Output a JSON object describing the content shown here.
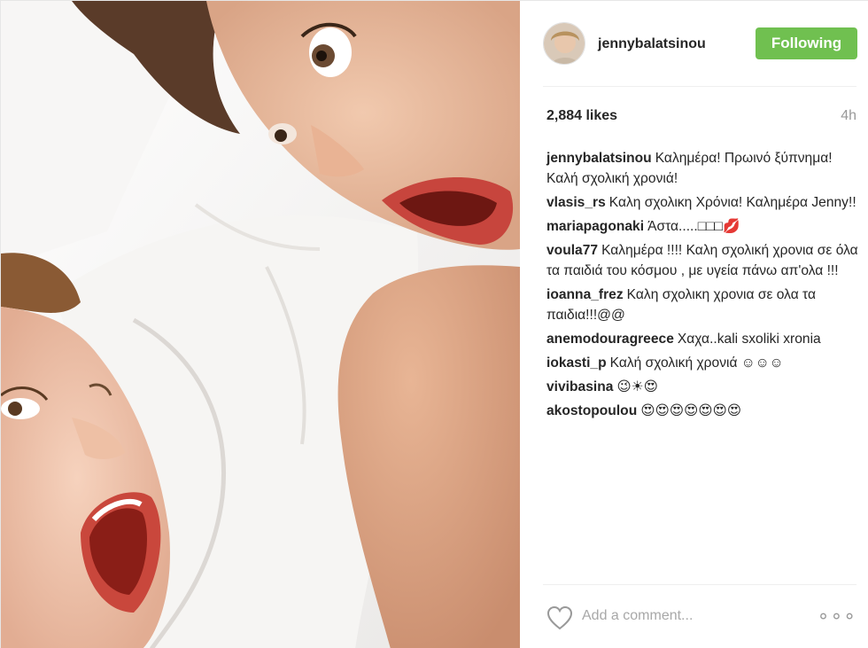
{
  "post": {
    "username": "jennybalatsinou",
    "follow_label": "Following",
    "likes": "2,884 likes",
    "time": "4h",
    "comments": [
      {
        "user": "jennybalatsinou",
        "text": "Καλημέρα! Πρωινό ξύπνημα! Καλή σχολική χρονιά!"
      },
      {
        "user": "vlasis_rs",
        "text": "Καλη σχολικη Χρόνια! Καλημέρα Jenny!!"
      },
      {
        "user": "mariapagonaki",
        "text": "Άστα.....□□□💋"
      },
      {
        "user": "voula77",
        "text": "Καλημέρα !!!! Καλη σχολική χρονια σε όλα τα παιδιά του κόσμου , με υγεία πάνω απ'ολα !!!"
      },
      {
        "user": "ioanna_frez",
        "text": "Καλη σχολικη χρονια σε ολα τα παιδια!!!@@"
      },
      {
        "user": "anemodouragreece",
        "text": "Χαχα..kali sxoliki xronia"
      },
      {
        "user": "iokasti_p",
        "text": "Καλή σχολική χρονιά ☺☺☺"
      },
      {
        "user": "vivibasina",
        "text": "😉☀😍"
      },
      {
        "user": "akostopoulou",
        "text": "😍😍😍😍😍😍😍"
      }
    ],
    "add_comment_placeholder": "Add a comment...",
    "more_label": "∘∘∘"
  },
  "colors": {
    "follow_green": "#70c050",
    "muted": "#999999"
  },
  "icons": {
    "like": "heart-icon",
    "more": "more-options-icon"
  }
}
